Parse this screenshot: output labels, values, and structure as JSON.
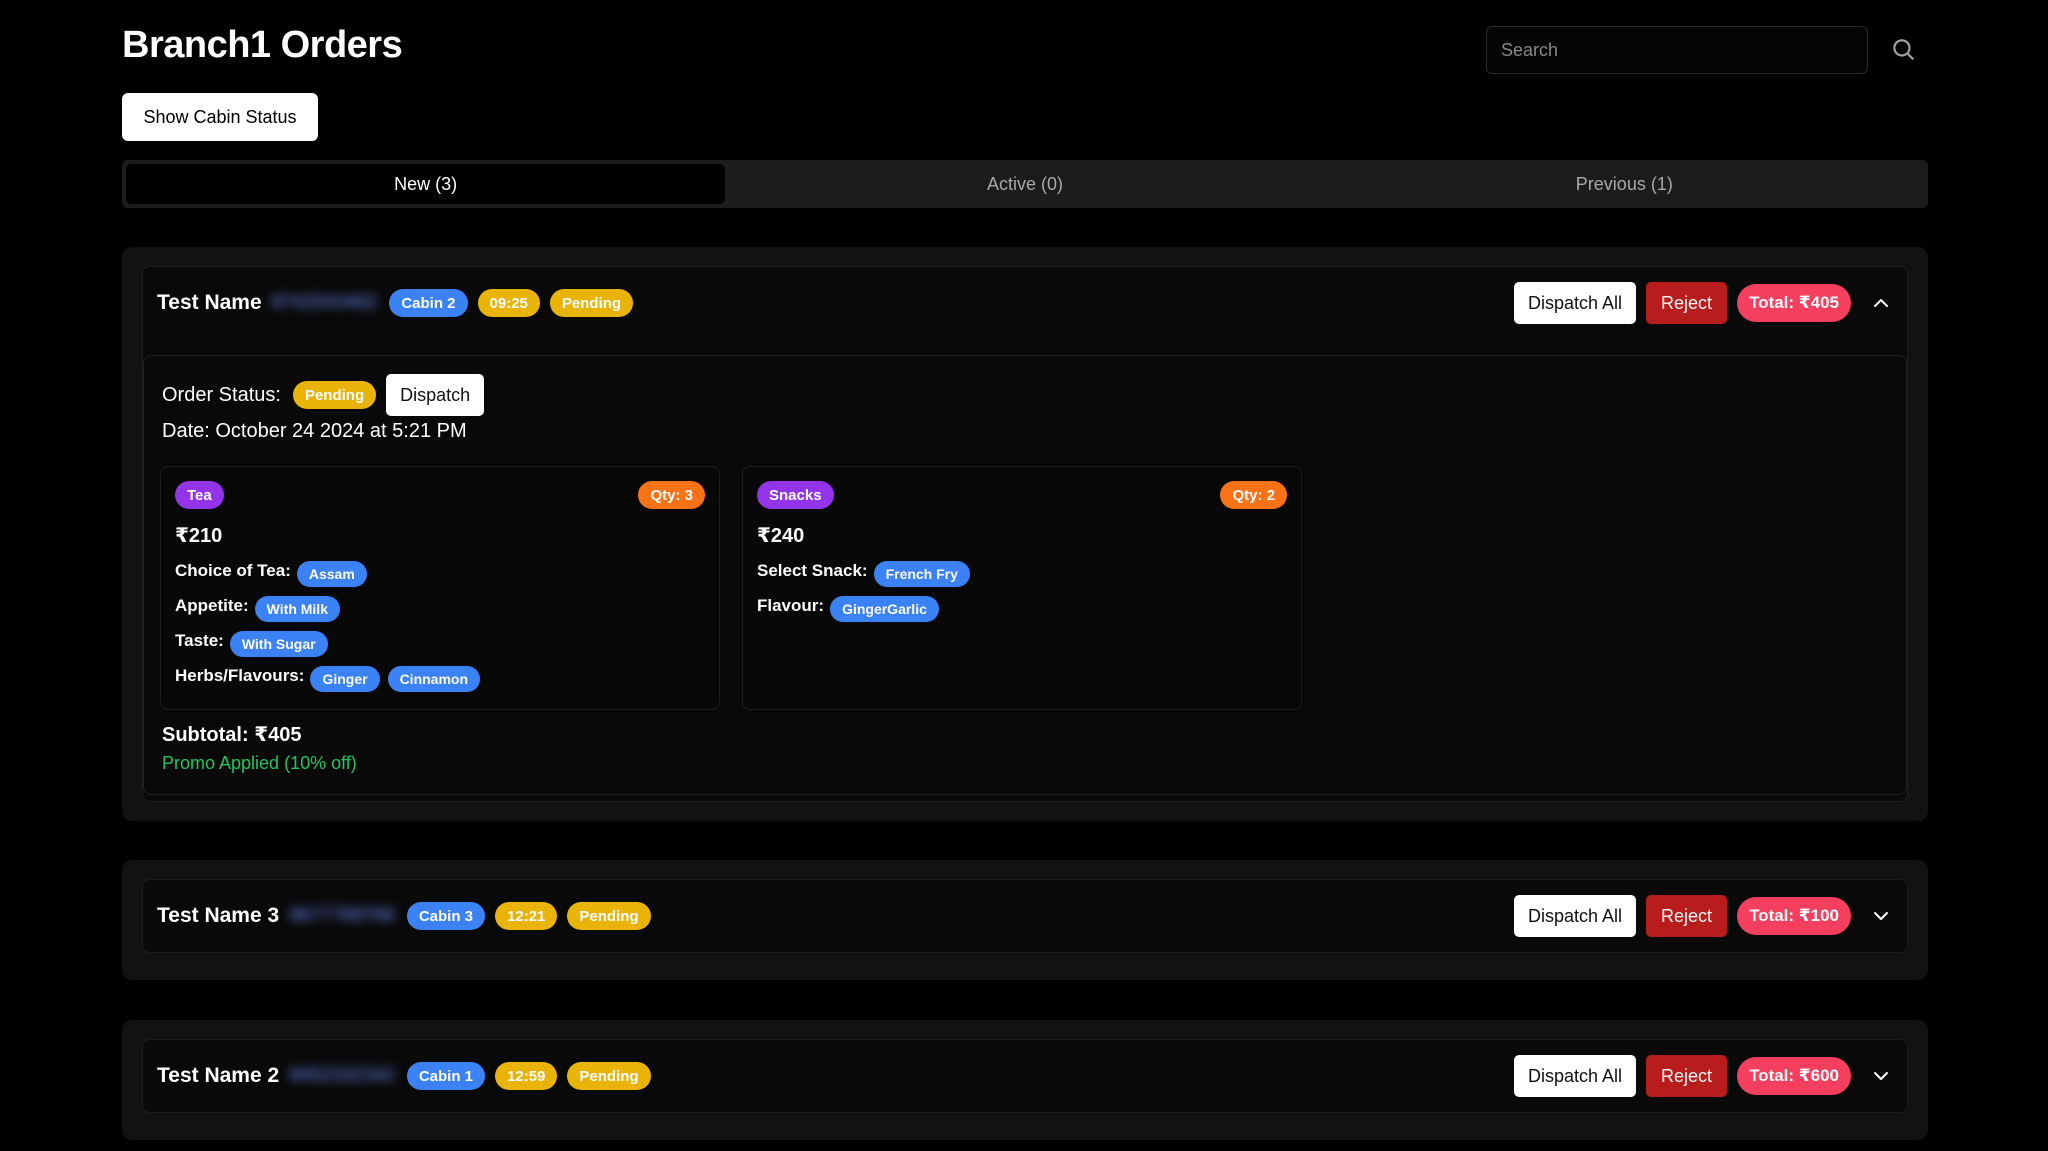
{
  "page": {
    "title": "Branch1 Orders"
  },
  "search": {
    "placeholder": "Search"
  },
  "show_cabin_status_label": "Show Cabin Status",
  "tabs": [
    {
      "label": "New (3)",
      "active": true
    },
    {
      "label": "Active (0)",
      "active": false
    },
    {
      "label": "Previous (1)",
      "active": false
    }
  ],
  "order_labels": {
    "dispatch_all": "Dispatch All",
    "reject": "Reject",
    "dispatch": "Dispatch",
    "order_status": "Order Status:"
  },
  "orders": [
    {
      "customer_name": "Test Name",
      "phone_blurred": "8742543462",
      "cabin": "Cabin 2",
      "time": "09:25",
      "status": "Pending",
      "total": "Total: ₹405",
      "expanded": true,
      "detail": {
        "order_status": "Pending",
        "date": "Date: October 24 2024 at 5:21 PM",
        "items": [
          {
            "category": "Tea",
            "qty": "Qty: 3",
            "price": "₹210",
            "options": [
              {
                "label": "Choice of Tea:",
                "values": [
                  "Assam"
                ]
              },
              {
                "label": "Appetite:",
                "values": [
                  "With Milk"
                ]
              },
              {
                "label": "Taste:",
                "values": [
                  "With Sugar"
                ]
              },
              {
                "label": "Herbs/Flavours:",
                "values": [
                  "Ginger",
                  "Cinnamon"
                ]
              }
            ]
          },
          {
            "category": "Snacks",
            "qty": "Qty: 2",
            "price": "₹240",
            "options": [
              {
                "label": "Select Snack:",
                "values": [
                  "French Fry"
                ]
              },
              {
                "label": "Flavour:",
                "values": [
                  "GingerGarlic"
                ]
              }
            ]
          }
        ],
        "subtotal": "Subtotal: ₹405",
        "promo": "Promo Applied (10% off)"
      }
    },
    {
      "customer_name": "Test Name 3",
      "phone_blurred": "9677789766",
      "cabin": "Cabin 3",
      "time": "12:21",
      "status": "Pending",
      "total": "Total: ₹100",
      "expanded": false
    },
    {
      "customer_name": "Test Name 2",
      "phone_blurred": "9452332342",
      "cabin": "Cabin 1",
      "time": "12:59",
      "status": "Pending",
      "total": "Total: ₹600",
      "expanded": false
    }
  ],
  "colors": {
    "background": "#000000",
    "cabin_badge": "#3b82f6",
    "time_badge": "#eab308",
    "status_badge": "#eab308",
    "category_badge": "#9333ea",
    "qty_badge": "#f97316",
    "total_badge": "#f43f5e",
    "reject_button": "#b91c1c",
    "promo_text": "#22c55e"
  },
  "icons": {
    "search": "search-icon",
    "collapse": "chevron-up-icon",
    "expand": "chevron-down-icon"
  }
}
